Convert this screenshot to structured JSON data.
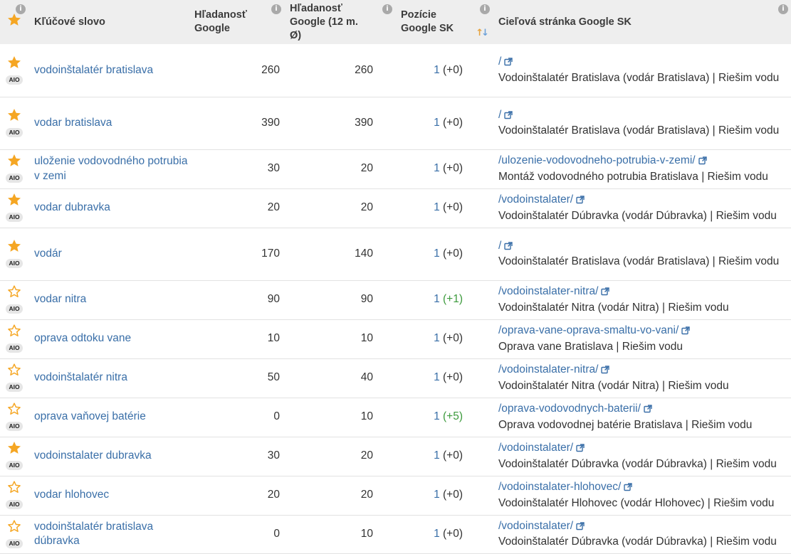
{
  "header": {
    "keyword": "Kľúčové slovo",
    "search_google": "Hľadanosť Google",
    "search_google_12m": "Hľadanosť Google (12 m. Ø)",
    "position": "Pozície Google SK",
    "target_page": "Cieľová stránka Google SK",
    "info_glyph": "i"
  },
  "colors": {
    "star_filled": "#f5a623",
    "link": "#3a6fa8",
    "positive_change": "#3c9a3c",
    "header_bg": "#eeeeee"
  },
  "icons": {
    "star": "star-icon",
    "info": "info-icon",
    "external": "external-link-icon",
    "sort": "sort-icon"
  },
  "rows": [
    {
      "starred": true,
      "badge": "AIO",
      "keyword": "vodoinštalatér bratislava",
      "search": "260",
      "search12": "260",
      "pos": "1",
      "change": "(+0)",
      "url": "/",
      "title": "Vodoinštalatér Bratislava (vodár Bratislava) | Riešim vodu"
    },
    {
      "starred": true,
      "badge": "AIO",
      "keyword": "vodar bratislava",
      "search": "390",
      "search12": "390",
      "pos": "1",
      "change": "(+0)",
      "url": "/",
      "title": "Vodoinštalatér Bratislava (vodár Bratislava) | Riešim vodu"
    },
    {
      "starred": true,
      "badge": "AIO",
      "keyword": "uloženie vodovodného potrubia v zemi",
      "search": "30",
      "search12": "20",
      "pos": "1",
      "change": "(+0)",
      "url": "/ulozenie-vodovodneho-potrubia-v-zemi/",
      "title": "Montáž vodovodného potrubia Bratislava | Riešim vodu"
    },
    {
      "starred": true,
      "badge": "AIO",
      "keyword": "vodar dubravka",
      "search": "20",
      "search12": "20",
      "pos": "1",
      "change": "(+0)",
      "url": "/vodoinstalater/",
      "title": "Vodoinštalatér Dúbravka (vodár Dúbravka) | Riešim vodu"
    },
    {
      "starred": true,
      "badge": "AIO",
      "keyword": "vodár",
      "search": "170",
      "search12": "140",
      "pos": "1",
      "change": "(+0)",
      "url": "/",
      "title": "Vodoinštalatér Bratislava (vodár Bratislava) | Riešim vodu"
    },
    {
      "starred": false,
      "badge": "AIO",
      "keyword": "vodar nitra",
      "search": "90",
      "search12": "90",
      "pos": "1",
      "change": "(+1)",
      "url": "/vodoinstalater-nitra/",
      "title": "Vodoinštalatér Nitra (vodár Nitra) | Riešim vodu"
    },
    {
      "starred": false,
      "badge": "AIO",
      "keyword": "oprava odtoku vane",
      "search": "10",
      "search12": "10",
      "pos": "1",
      "change": "(+0)",
      "url": "/oprava-vane-oprava-smaltu-vo-vani/",
      "title": "Oprava vane Bratislava | Riešim vodu"
    },
    {
      "starred": false,
      "badge": "AIO",
      "keyword": "vodoinštalatér nitra",
      "search": "50",
      "search12": "40",
      "pos": "1",
      "change": "(+0)",
      "url": "/vodoinstalater-nitra/",
      "title": "Vodoinštalatér Nitra (vodár Nitra) | Riešim vodu"
    },
    {
      "starred": false,
      "badge": "AIO",
      "keyword": "oprava vaňovej batérie",
      "search": "0",
      "search12": "10",
      "pos": "1",
      "change": "(+5)",
      "url": "/oprava-vodovodnych-baterii/",
      "title": "Oprava vodovodnej batérie Bratislava | Riešim vodu"
    },
    {
      "starred": true,
      "badge": "AIO",
      "keyword": "vodoinstalater dubravka",
      "search": "30",
      "search12": "20",
      "pos": "1",
      "change": "(+0)",
      "url": "/vodoinstalater/",
      "title": "Vodoinštalatér Dúbravka (vodár Dúbravka) | Riešim vodu"
    },
    {
      "starred": false,
      "badge": "AIO",
      "keyword": "vodar hlohovec",
      "search": "20",
      "search12": "20",
      "pos": "1",
      "change": "(+0)",
      "url": "/vodoinstalater-hlohovec/",
      "title": "Vodoinštalatér Hlohovec (vodár Hlohovec) | Riešim vodu"
    },
    {
      "starred": false,
      "badge": "AIO",
      "keyword": "vodoinštalatér bratislava dúbravka",
      "search": "0",
      "search12": "10",
      "pos": "1",
      "change": "(+0)",
      "url": "/vodoinstalater/",
      "title": "Vodoinštalatér Dúbravka (vodár Dúbravka) | Riešim vodu"
    }
  ]
}
